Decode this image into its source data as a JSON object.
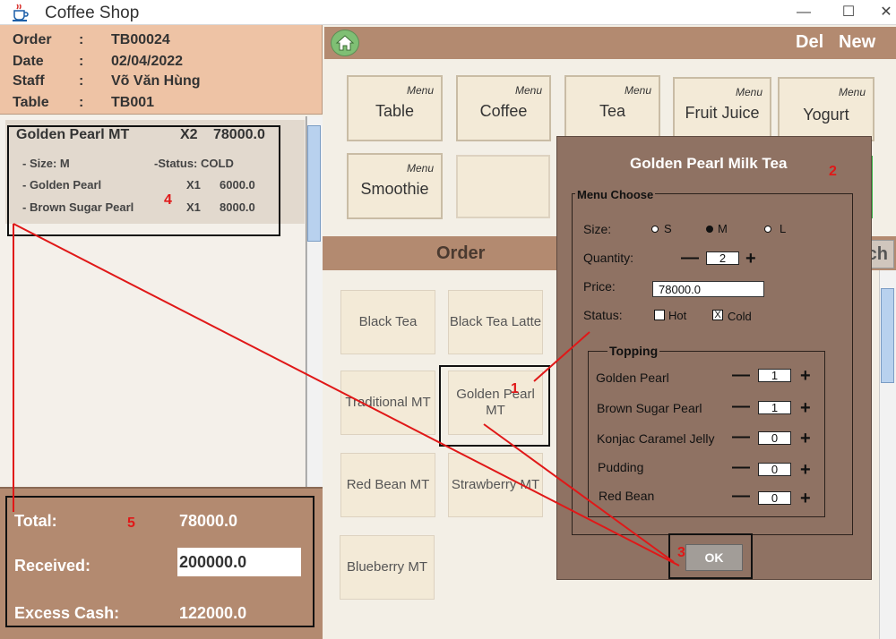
{
  "window": {
    "title": "Coffee Shop",
    "minimize": "—",
    "maximize": "☐",
    "close": "✕"
  },
  "order_info": {
    "labels": [
      "Order",
      "Date",
      "Staff",
      "Table"
    ],
    "values": [
      "TB00024",
      "02/04/2022",
      "Võ Văn Hùng",
      "TB001"
    ],
    "separator": ":"
  },
  "order_item": {
    "name": "Golden Pearl MT",
    "qty": "X2",
    "price": "78000.0",
    "size": "- Size: M",
    "status": "-Status: COLD",
    "toppings": [
      {
        "name": "- Golden Pearl",
        "qty": "X1",
        "price": "6000.0"
      },
      {
        "name": "- Brown Sugar Pearl",
        "qty": "X1",
        "price": "8000.0"
      }
    ]
  },
  "totals": {
    "total_label": "Total:",
    "total_value": "78000.0",
    "received_label": "Received:",
    "received_value": "200000.0",
    "excess_label": "Excess Cash:",
    "excess_value": "122000.0"
  },
  "toolbar": {
    "del": "Del",
    "new": "New"
  },
  "categories": {
    "tag": "Menu",
    "items": [
      "Table",
      "Coffee",
      "Tea",
      "Fruit Juice",
      "Yogurt",
      "Smoothie"
    ]
  },
  "order_section": {
    "title": "Order",
    "search_partial": "ch"
  },
  "products": [
    "Black Tea",
    "Black Tea Latte",
    "Traditional MT",
    "Golden Pearl MT",
    "Red Bean MT",
    "Strawberry MT",
    "Blueberry MT"
  ],
  "dialog": {
    "title": "Golden Pearl Milk Tea",
    "group_label": "Menu Choose",
    "size_label": "Size:",
    "size_options": [
      "S",
      "M",
      "L"
    ],
    "size_selected": "M",
    "quantity_label": "Quantity:",
    "quantity": "2",
    "price_label": "Price:",
    "price": "78000.0",
    "status_label": "Status:",
    "status_options": [
      "Hot",
      "Cold"
    ],
    "status_selected": "Cold",
    "cold_mark": "X",
    "topping_label": "Topping",
    "toppings": [
      {
        "name": "Golden Pearl",
        "qty": "1"
      },
      {
        "name": "Brown Sugar Pearl",
        "qty": "1"
      },
      {
        "name": "Konjac Caramel Jelly",
        "qty": "0"
      },
      {
        "name": "Pudding",
        "qty": "0"
      },
      {
        "name": "Red Bean",
        "qty": "0"
      }
    ],
    "minus": "—",
    "plus": "+",
    "ok": "OK"
  },
  "annotations": [
    "1",
    "2",
    "3",
    "4",
    "5"
  ],
  "colors": {
    "header_peach": "#eec3a5",
    "brown_bar": "#b38a70",
    "dialog_bg": "#8f7263",
    "tile_bg": "#f3ead7",
    "annotation_red": "#e01818"
  }
}
